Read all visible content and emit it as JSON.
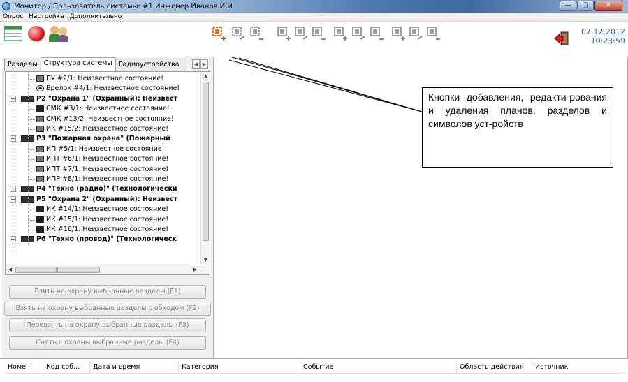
{
  "window": {
    "title": "Монитор / Пользователь системы: #1 Инженер Иванов И И",
    "btn_min": "—",
    "btn_max": "▢",
    "btn_close": "✕"
  },
  "menu": [
    "Опрос",
    "Настройка",
    "Дополнительно"
  ],
  "toolbar": {
    "left_icons": [
      "notebook-icon",
      "ball-icon",
      "users-icon"
    ],
    "plan_icons": [
      {
        "name": "add-plan-icon",
        "active": true
      },
      {
        "name": "edit-plan-icon",
        "active": false
      },
      {
        "name": "delete-plan-icon",
        "active": false
      },
      {
        "name": "add-section-icon",
        "active": false
      },
      {
        "name": "edit-section-icon",
        "active": false
      },
      {
        "name": "delete-section-icon",
        "active": false
      },
      {
        "name": "add-device-icon",
        "active": false
      },
      {
        "name": "remove-device-icon",
        "active": false
      },
      {
        "name": "group-device-icon",
        "active": false
      },
      {
        "name": "add-symbol-icon",
        "active": false
      },
      {
        "name": "remove-symbol-icon",
        "active": false
      },
      {
        "name": "symbol-panel-icon",
        "active": false
      }
    ],
    "exit_icon": "exit-icon",
    "date": "07.12.2012",
    "time": "10:23:59"
  },
  "tabs": [
    "Разделы",
    "Структура системы",
    "Радиоустройства"
  ],
  "tree": [
    {
      "text": "ПУ #2/1: Неизвестное состояние!",
      "icon": "device",
      "level": 2,
      "bold": false
    },
    {
      "text": "Брелок #4/1: Неизвестное состояние!",
      "icon": "circle",
      "level": 2,
      "bold": false
    },
    {
      "text": "Р2 \"Охрана 1\" (Охранный): Неизвест",
      "icon": "wide",
      "level": 1,
      "bold": true
    },
    {
      "text": "СМК #3/1: Неизвестное состояние!",
      "icon": "dark",
      "level": 2,
      "bold": false
    },
    {
      "text": "СМК #13/2: Неизвестное состояние!",
      "icon": "device",
      "level": 2,
      "bold": false
    },
    {
      "text": "ИК #15/2: Неизвестное состояние!",
      "icon": "device",
      "level": 2,
      "bold": false
    },
    {
      "text": "Р3 \"Пожарная охрана\" (Пожарный",
      "icon": "wide",
      "level": 1,
      "bold": true
    },
    {
      "text": "ИП #5/1: Неизвестное состояние!",
      "icon": "device",
      "level": 2,
      "bold": false
    },
    {
      "text": "ИПТ #6/1: Неизвестное состояние!",
      "icon": "device",
      "level": 2,
      "bold": false
    },
    {
      "text": "ИПТ #7/1: Неизвестное состояние!",
      "icon": "device",
      "level": 2,
      "bold": false
    },
    {
      "text": "ИПР #8/1: Неизвестное состояние!",
      "icon": "device",
      "level": 2,
      "bold": false
    },
    {
      "text": "Р4 \"Техно (радио)\" (Технологически",
      "icon": "wide",
      "level": 1,
      "bold": true
    },
    {
      "text": "Р5 \"Охрана 2\" (Охранный): Неизвест",
      "icon": "wide",
      "level": 1,
      "bold": true
    },
    {
      "text": "ИК #14/1: Неизвестное состояние!",
      "icon": "dark",
      "level": 2,
      "bold": false
    },
    {
      "text": "ИК #15/1: Неизвестное состояние!",
      "icon": "dark",
      "level": 2,
      "bold": false
    },
    {
      "text": "ИК #16/1: Неизвестное состояние!",
      "icon": "dark",
      "level": 2,
      "bold": false
    },
    {
      "text": "Р6 \"Техно (провод)\" (Технологическ",
      "icon": "wide",
      "level": 1,
      "bold": true
    }
  ],
  "commands": [
    "Взять на охрану выбранные разделы (F1)",
    "Взять на охрану выбранные разделы с обходом (F2)",
    "Перевзять на охрану выбранные разделы (F3)",
    "Снять с охраны выбранные разделы (F4)"
  ],
  "callout": "Кнопки добавления, редакти-рования и удаления планов, разделов и символов уст-ройств",
  "events_columns": [
    "Номе...",
    "Код соб...",
    "Дата и время",
    "Категория",
    "Событие",
    "Область действия",
    "Источник"
  ]
}
